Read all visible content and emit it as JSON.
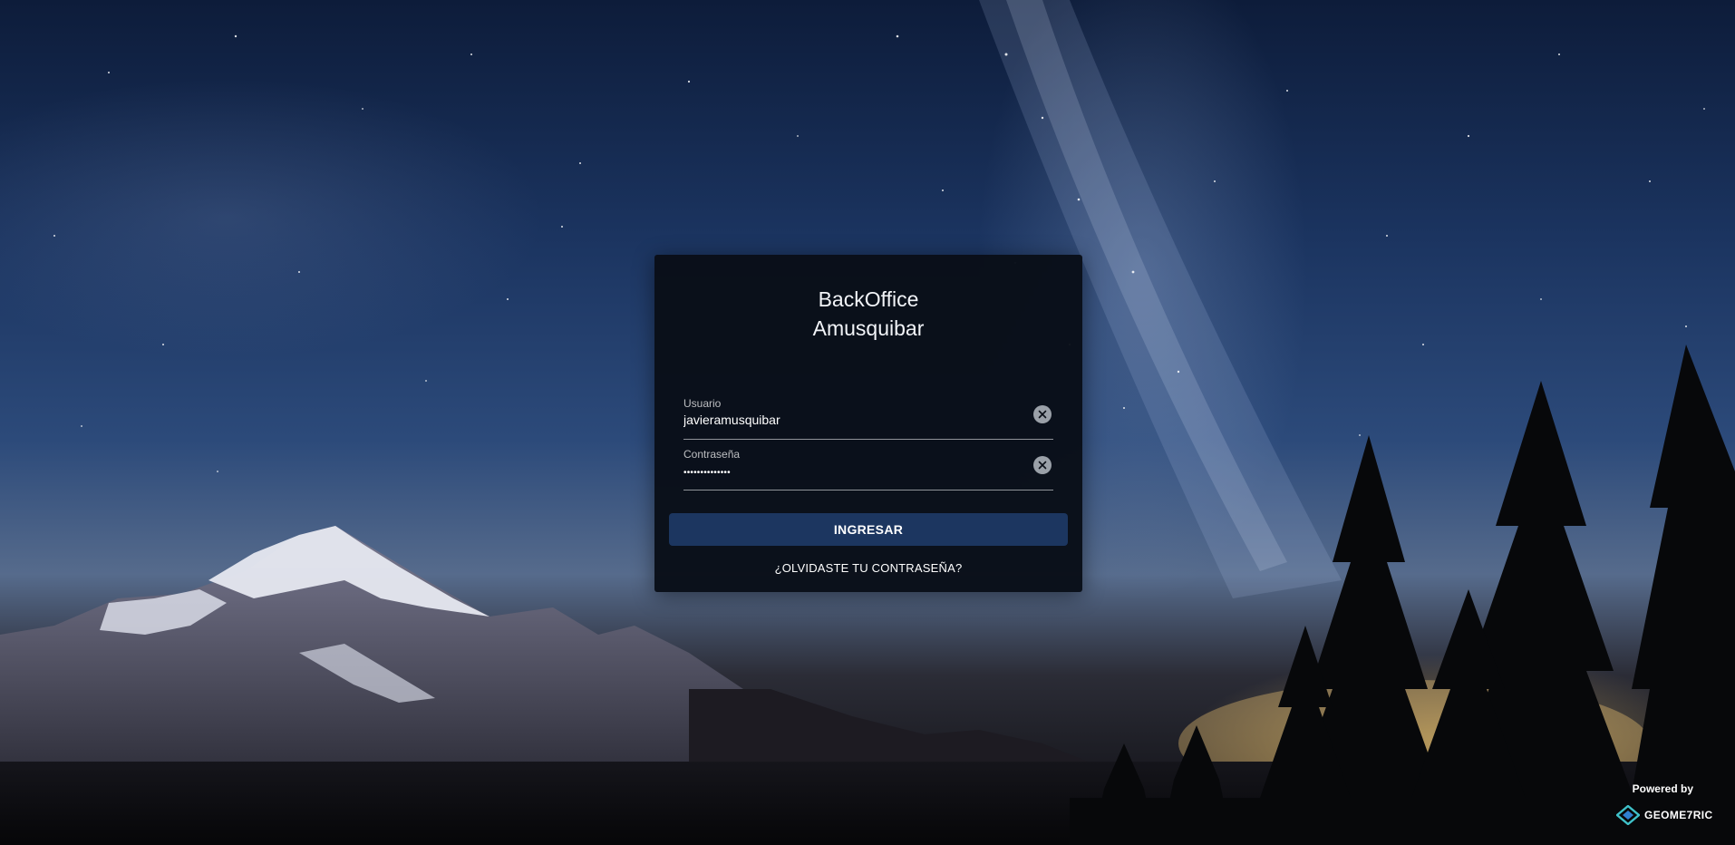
{
  "login": {
    "title_line1": "BackOffice",
    "title_line2": "Amusquibar",
    "username": {
      "label": "Usuario",
      "value": "javieramusquibar"
    },
    "password": {
      "label": "Contraseña",
      "value": "••••••••••••••"
    },
    "submit_label": "INGRESAR",
    "forgot_label": "¿OLVIDASTE TU CONTRASEÑA?"
  },
  "footer": {
    "powered_by": "Powered by",
    "brand_name": "GEOME7RIC",
    "brand_icon": "geometric-logo-icon"
  },
  "colors": {
    "card_background": "#090e18",
    "button_background": "#1c3660",
    "text": "#ffffff",
    "brand_accent": "#3fc1c9"
  }
}
